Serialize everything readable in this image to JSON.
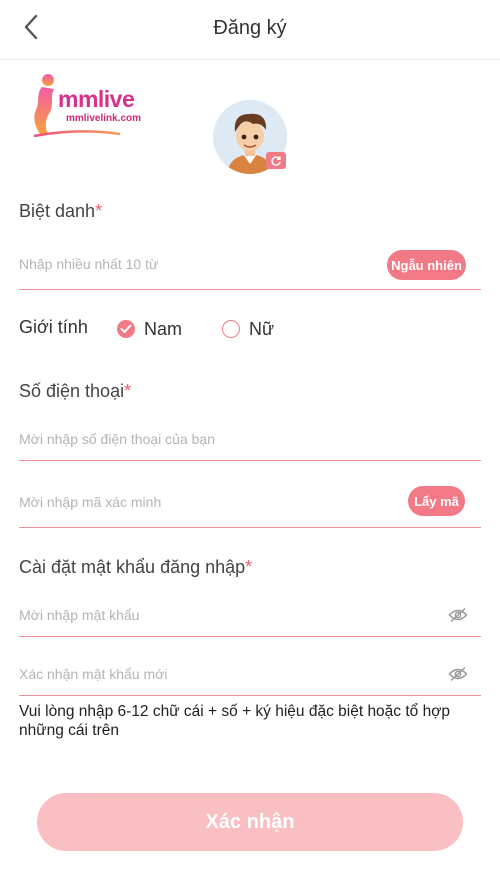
{
  "header": {
    "title": "Đăng ký"
  },
  "brand": {
    "logo_word": "mmlive",
    "logo_domain": "mmlivelink.com"
  },
  "nickname": {
    "label": "Biệt danh",
    "required_mark": "*",
    "placeholder": "Nhập nhiều nhất 10 từ",
    "random_button": "Ngẫu nhiên"
  },
  "gender": {
    "label": "Giới tính",
    "options": [
      {
        "label": "Nam",
        "checked": true
      },
      {
        "label": "Nữ",
        "checked": false
      }
    ]
  },
  "phone": {
    "label": "Số điện thoại",
    "required_mark": "*",
    "placeholder": "Mời nhập số điện thoại của bạn",
    "code_placeholder": "Mời nhập mã xác minh",
    "get_code_button": "Lấy mã"
  },
  "password": {
    "label": "Cài đặt mật khẩu đăng nhập",
    "required_mark": "*",
    "placeholder": "Mời nhập mật khẩu",
    "confirm_placeholder": "Xác nhận mật khẩu mới",
    "hint": "Vui lòng nhập 6-12 chữ cái + số + ký hiệu đặc biệt hoặc tổ hợp những cái trên"
  },
  "submit": {
    "label": "Xác nhận"
  },
  "colors": {
    "accent": "#f27a86",
    "submit_bg": "#f9bfc3",
    "brand": "#d9308c"
  },
  "icons": [
    "back-arrow-icon",
    "refresh-icon",
    "eye-slash-icon",
    "check-icon"
  ]
}
